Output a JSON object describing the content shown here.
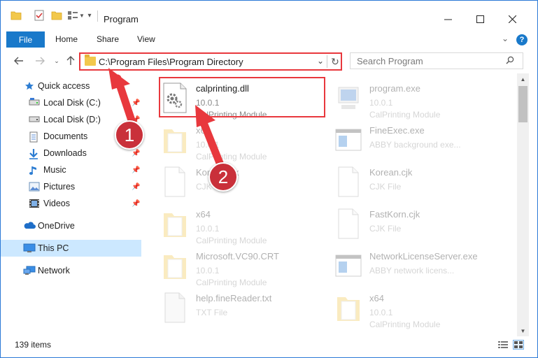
{
  "window": {
    "title": "Program"
  },
  "ribbon": {
    "tabs": [
      "File",
      "Home",
      "Share",
      "View"
    ]
  },
  "address": {
    "path": "C:\\Program Files\\Program Directory"
  },
  "search": {
    "placeholder": "Search Program"
  },
  "navpane": {
    "items": [
      {
        "label": "Quick access",
        "icon": "star-icon"
      },
      {
        "label": "Local Disk (C:)",
        "icon": "drive-icon"
      },
      {
        "label": "Local Disk (D:)",
        "icon": "drive-icon"
      },
      {
        "label": "Documents",
        "icon": "documents-icon"
      },
      {
        "label": "Downloads",
        "icon": "download-icon"
      },
      {
        "label": "Music",
        "icon": "music-icon"
      },
      {
        "label": "Pictures",
        "icon": "pictures-icon"
      },
      {
        "label": "Videos",
        "icon": "videos-icon"
      },
      {
        "label": "OneDrive",
        "icon": "cloud-icon"
      },
      {
        "label": "This PC",
        "icon": "computer-icon"
      },
      {
        "label": "Network",
        "icon": "network-icon"
      }
    ]
  },
  "files": [
    {
      "name": "calprinting.dll",
      "line2": "10.0.1",
      "line3": "CalPrinting Module",
      "icon": "dll-gear-icon"
    },
    {
      "name": "program.exe",
      "line2": "10.0.1",
      "line3": "CalPrinting Module",
      "icon": "exe-icon"
    },
    {
      "name": "x64",
      "line2": "10.0.1",
      "line3": "CalPrinting Module",
      "icon": "folder-doc-icon"
    },
    {
      "name": "FineExec.exe",
      "line2": "ABBY background exe...",
      "line3": "",
      "icon": "window-exe-icon"
    },
    {
      "name": "Korean.cjk",
      "line2": "CJK File",
      "line3": "",
      "icon": "blank-file-icon"
    },
    {
      "name": "Korean.cjk",
      "line2": "CJK File",
      "line3": "",
      "icon": "blank-file-icon"
    },
    {
      "name": "x64",
      "line2": "10.0.1",
      "line3": "CalPrinting Module",
      "icon": "folder-doc-icon"
    },
    {
      "name": "FastKorn.cjk",
      "line2": "CJK File",
      "line3": "",
      "icon": "blank-file-icon"
    },
    {
      "name": "Microsoft.VC90.CRT",
      "line2": "10.0.1",
      "line3": "CalPrinting Module",
      "icon": "folder-doc-icon"
    },
    {
      "name": "NetworkLicenseServer.exe",
      "line2": "ABBY network licens...",
      "line3": "",
      "icon": "window-exe-icon"
    },
    {
      "name": "help.fineReader.txt",
      "line2": "TXT File",
      "line3": "",
      "icon": "text-file-icon"
    },
    {
      "name": "x64",
      "line2": "10.0.1",
      "line3": "CalPrinting Module",
      "icon": "folder-doc-icon"
    }
  ],
  "status": {
    "count": "139 items"
  },
  "annotations": {
    "badge1": "1",
    "badge2": "2"
  },
  "colors": {
    "accent": "#1979ca",
    "highlight": "#e8383d",
    "badge": "#c9303a",
    "selection": "#cce8ff"
  }
}
